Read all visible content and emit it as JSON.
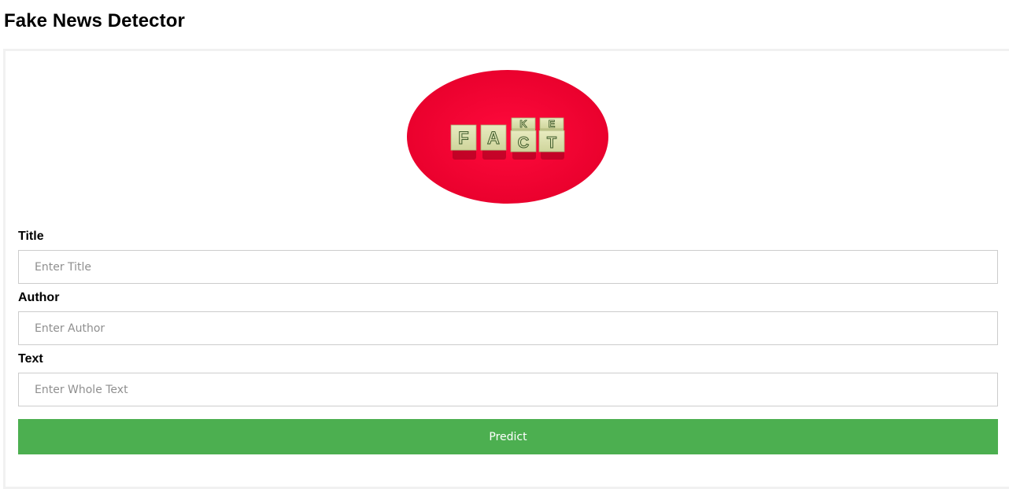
{
  "page": {
    "title": "Fake News Detector"
  },
  "logo": {
    "icon": "fake-fact-blocks-image",
    "block_letters_top": [
      "K",
      "E"
    ],
    "block_letters_bottom": [
      "F",
      "A",
      "C",
      "T"
    ],
    "background_color": "#f0002f"
  },
  "form": {
    "title_label": "Title",
    "title_placeholder": "Enter Title",
    "title_value": "",
    "author_label": "Author",
    "author_placeholder": "Enter Author",
    "author_value": "",
    "text_label": "Text",
    "text_placeholder": "Enter Whole Text",
    "text_value": "",
    "submit_label": "Predict"
  },
  "colors": {
    "button": "#4caf50",
    "button_text": "#ffffff",
    "border": "#cccccc"
  }
}
